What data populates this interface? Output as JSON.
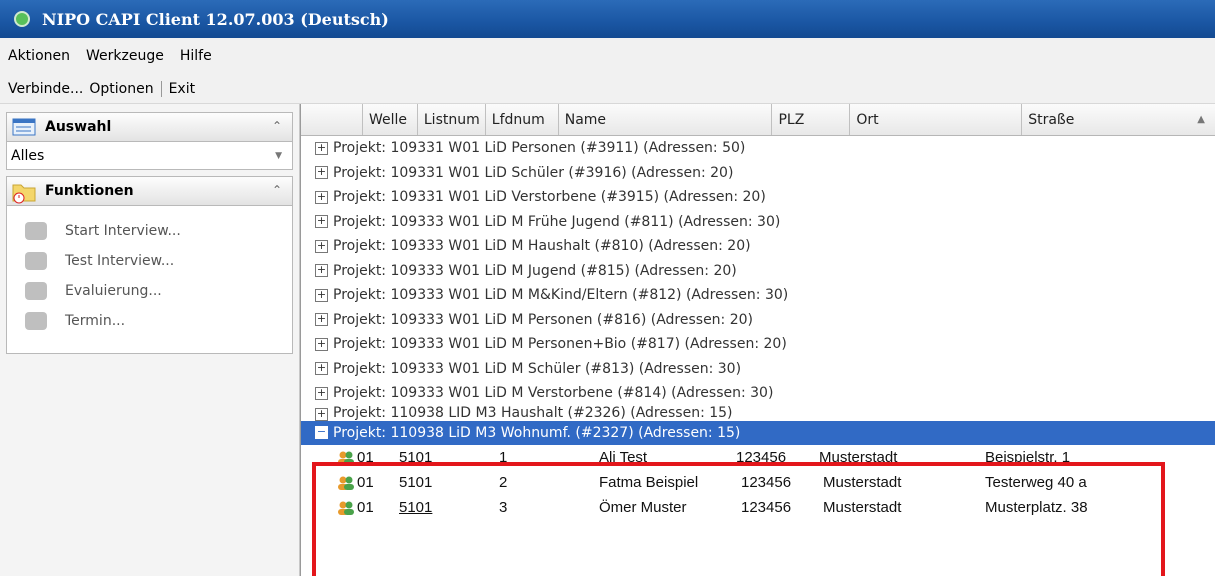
{
  "window": {
    "title": "NIPO CAPI Client 12.07.003 (Deutsch)"
  },
  "menubar": {
    "items": [
      {
        "label": "Aktionen"
      },
      {
        "label": "Werkzeuge"
      },
      {
        "label": "Hilfe"
      }
    ]
  },
  "toolbar": {
    "connect": "Verbinde...",
    "options": "Optionen",
    "exit": "Exit"
  },
  "sidebar": {
    "selection": {
      "title": "Auswahl",
      "value": "Alles"
    },
    "functions": {
      "title": "Funktionen",
      "items": [
        {
          "label": "Start Interview...",
          "icon": "start-interview-icon"
        },
        {
          "label": "Test Interview...",
          "icon": "test-interview-icon"
        },
        {
          "label": "Evaluierung...",
          "icon": "evaluation-icon"
        },
        {
          "label": "Termin...",
          "icon": "appointment-icon"
        }
      ]
    }
  },
  "grid": {
    "columns": [
      "Welle",
      "Listnum",
      "Lfdnum",
      "Name",
      "PLZ",
      "Ort",
      "Straße"
    ],
    "groups": [
      "Projekt: 109331 W01 LiD Personen (#3911) (Adressen: 50)",
      "Projekt: 109331 W01 LiD Schüler (#3916) (Adressen: 20)",
      "Projekt: 109331 W01 LiD Verstorbene (#3915) (Adressen: 20)",
      "Projekt: 109333 W01 LiD M Frühe Jugend (#811) (Adressen: 30)",
      "Projekt: 109333 W01 LiD M Haushalt (#810) (Adressen: 20)",
      "Projekt: 109333 W01 LiD M Jugend (#815) (Adressen: 20)",
      "Projekt: 109333 W01 LiD M M&Kind/Eltern (#812) (Adressen: 30)",
      "Projekt: 109333 W01 LiD M Personen (#816) (Adressen: 20)",
      "Projekt: 109333 W01 LiD M Personen+Bio (#817) (Adressen: 20)",
      "Projekt: 109333 W01 LiD M Schüler (#813) (Adressen: 30)",
      "Projekt: 109333 W01 LiD M Verstorbene (#814) (Adressen: 30)",
      "Projekt: 110938 LID M3 Haushalt (#2326) (Adressen: 15)"
    ],
    "selected_group": "Projekt: 110938 LiD M3 Wohnumf. (#2327) (Adressen: 15)",
    "rows": [
      {
        "welle": "01",
        "listnum": "5101",
        "lfdnum": "1",
        "name": "Ali Test",
        "plz": "123456",
        "ort": "Musterstadt",
        "strasse": "Beispielstr. 1"
      },
      {
        "welle": "01",
        "listnum": "5101",
        "lfdnum": "2",
        "name": "Fatma Beispiel",
        "plz": "123456",
        "ort": "Musterstadt",
        "strasse": "Testerweg 40 a"
      },
      {
        "welle": "01",
        "listnum": "5101",
        "lfdnum": "3",
        "name": "Ömer Muster",
        "plz": "123456",
        "ort": "Musterstadt",
        "strasse": "Musterplatz. 38"
      }
    ]
  },
  "colors": {
    "title_bar": "#1a56a3",
    "selection": "#316ac5",
    "highlight_frame": "#e3161b"
  }
}
